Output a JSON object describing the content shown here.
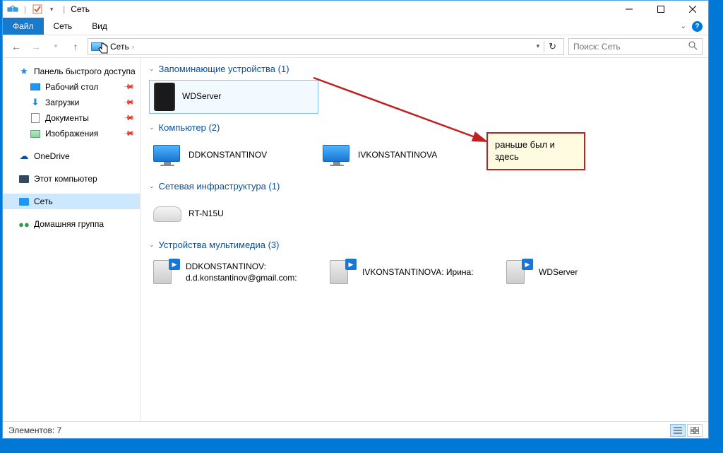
{
  "window": {
    "title": "Сеть"
  },
  "ribbon": {
    "file": "Файл",
    "tab_network": "Сеть",
    "tab_view": "Вид"
  },
  "address": {
    "crumb": "Сеть"
  },
  "search": {
    "placeholder": "Поиск: Сеть"
  },
  "sidebar": {
    "quick_access": "Панель быстрого доступа",
    "desktop": "Рабочий стол",
    "downloads": "Загрузки",
    "documents": "Документы",
    "pictures": "Изображения",
    "onedrive": "OneDrive",
    "this_pc": "Этот компьютер",
    "network": "Сеть",
    "homegroup": "Домашняя группа"
  },
  "groups": {
    "storage": {
      "title": "Запоминающие устройства (1)",
      "items": [
        {
          "name": "WDServer"
        }
      ]
    },
    "computer": {
      "title": "Компьютер (2)",
      "items": [
        {
          "name": "DDKONSTANTINOV"
        },
        {
          "name": "IVKONSTANTINOVA"
        }
      ]
    },
    "infra": {
      "title": "Сетевая инфраструктура (1)",
      "items": [
        {
          "name": "RT-N15U"
        }
      ]
    },
    "media": {
      "title": "Устройства мультимедиа (3)",
      "items": [
        {
          "name": "DDKONSTANTINOV:",
          "sub": "d.d.konstantinov@gmail.com:"
        },
        {
          "name": "IVKONSTANTINOVA: Ирина:"
        },
        {
          "name": "WDServer"
        }
      ]
    }
  },
  "annotation": {
    "text": "раньше был и здесь"
  },
  "statusbar": {
    "count_label": "Элементов: 7"
  }
}
